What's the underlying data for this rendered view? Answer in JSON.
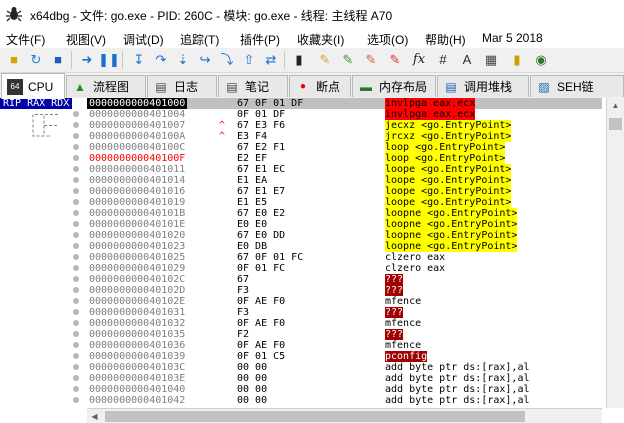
{
  "window": {
    "title": "x64dbg - 文件: go.exe - PID: 260C - 模块: go.exe - 线程: 主线程 A70"
  },
  "menu": {
    "items": [
      "文件(F)",
      "视图(V)",
      "调试(D)",
      "追踪(T)",
      "插件(P)",
      "收藏夹(I)",
      "选项(O)",
      "帮助(H)",
      "Mar 5 2018"
    ]
  },
  "tabs": [
    {
      "label": "CPU",
      "icon": "cpu-icon"
    },
    {
      "label": "流程图",
      "icon": "graph-icon"
    },
    {
      "label": "日志",
      "icon": "log-icon"
    },
    {
      "label": "笔记",
      "icon": "notes-icon"
    },
    {
      "label": "断点",
      "icon": "breakpoint-icon"
    },
    {
      "label": "内存布局",
      "icon": "memory-icon"
    },
    {
      "label": "调用堆栈",
      "icon": "callstack-icon"
    },
    {
      "label": "SEH链",
      "icon": "seh-icon"
    }
  ],
  "disasm": {
    "rip_label": "RIP RAX RDX",
    "rows": [
      {
        "addr": "0000000000401000",
        "mark": "",
        "bytes": "67 0F 01 DF",
        "instr": "invlpga",
        "arg": " eax,ecx",
        "style": "red"
      },
      {
        "addr": "0000000000401004",
        "mark": "",
        "bytes": "0F 01 DF",
        "instr": "invlpga",
        "arg": " eax,ecx",
        "style": "red"
      },
      {
        "addr": "0000000000401007",
        "mark": "^",
        "bytes": "67 E3 F6",
        "instr": "jecxz",
        "arg": " <go.EntryPoint>",
        "style": "yellow"
      },
      {
        "addr": "000000000040100A",
        "mark": "^",
        "bytes": "E3 F4",
        "instr": "jrcxz",
        "arg": " <go.EntryPoint>",
        "style": "yellow"
      },
      {
        "addr": "000000000040100C",
        "mark": "",
        "bytes": "67 E2 F1",
        "instr": "loop",
        "arg": " <go.EntryPoint>",
        "style": "yellow"
      },
      {
        "addr": "000000000040100F",
        "mark": "",
        "bytes": "E2 EF",
        "instr": "loop",
        "arg": " <go.EntryPoint>",
        "style": "yellow",
        "bp": true
      },
      {
        "addr": "0000000000401011",
        "mark": "",
        "bytes": "67 E1 EC",
        "instr": "loope",
        "arg": " <go.EntryPoint>",
        "style": "yellow"
      },
      {
        "addr": "0000000000401014",
        "mark": "",
        "bytes": "E1 EA",
        "instr": "loope",
        "arg": " <go.EntryPoint>",
        "style": "yellow"
      },
      {
        "addr": "0000000000401016",
        "mark": "",
        "bytes": "67 E1 E7",
        "instr": "loope",
        "arg": " <go.EntryPoint>",
        "style": "yellow"
      },
      {
        "addr": "0000000000401019",
        "mark": "",
        "bytes": "E1 E5",
        "instr": "loope",
        "arg": " <go.EntryPoint>",
        "style": "yellow"
      },
      {
        "addr": "000000000040101B",
        "mark": "",
        "bytes": "67 E0 E2",
        "instr": "loopne",
        "arg": " <go.EntryPoint>",
        "style": "yellow"
      },
      {
        "addr": "000000000040101E",
        "mark": "",
        "bytes": "E0 E0",
        "instr": "loopne",
        "arg": " <go.EntryPoint>",
        "style": "yellow"
      },
      {
        "addr": "0000000000401020",
        "mark": "",
        "bytes": "67 E0 DD",
        "instr": "loopne",
        "arg": " <go.EntryPoint>",
        "style": "yellow"
      },
      {
        "addr": "0000000000401023",
        "mark": "",
        "bytes": "E0 DB",
        "instr": "loopne",
        "arg": " <go.EntryPoint>",
        "style": "yellow"
      },
      {
        "addr": "0000000000401025",
        "mark": "",
        "bytes": "67 0F 01 FC",
        "instr": "clzero",
        "arg": " eax",
        "style": "none"
      },
      {
        "addr": "0000000000401029",
        "mark": "",
        "bytes": "0F 01 FC",
        "instr": "clzero",
        "arg": " eax",
        "style": "none"
      },
      {
        "addr": "000000000040102C",
        "mark": "",
        "bytes": "67",
        "instr": "???",
        "arg": "",
        "style": "dred"
      },
      {
        "addr": "000000000040102D",
        "mark": "",
        "bytes": "F3",
        "instr": "???",
        "arg": "",
        "style": "dred"
      },
      {
        "addr": "000000000040102E",
        "mark": "",
        "bytes": "0F AE F0",
        "instr": "mfence",
        "arg": "",
        "style": "none"
      },
      {
        "addr": "0000000000401031",
        "mark": "",
        "bytes": "F3",
        "instr": "???",
        "arg": "",
        "style": "dred"
      },
      {
        "addr": "0000000000401032",
        "mark": "",
        "bytes": "0F AE F0",
        "instr": "mfence",
        "arg": "",
        "style": "none"
      },
      {
        "addr": "0000000000401035",
        "mark": "",
        "bytes": "F2",
        "instr": "???",
        "arg": "",
        "style": "dred"
      },
      {
        "addr": "0000000000401036",
        "mark": "",
        "bytes": "0F AE F0",
        "instr": "mfence",
        "arg": "",
        "style": "none"
      },
      {
        "addr": "0000000000401039",
        "mark": "",
        "bytes": "0F 01 C5",
        "instr": "pconfig",
        "arg": "",
        "style": "dred"
      },
      {
        "addr": "000000000040103C",
        "mark": "",
        "bytes": "00 00",
        "instr": "add",
        "arg": " byte ptr ds:[rax],al",
        "style": "none"
      },
      {
        "addr": "000000000040103E",
        "mark": "",
        "bytes": "00 00",
        "instr": "add",
        "arg": " byte ptr ds:[rax],al",
        "style": "none"
      },
      {
        "addr": "0000000000401040",
        "mark": "",
        "bytes": "00 00",
        "instr": "add",
        "arg": " byte ptr ds:[rax],al",
        "style": "none"
      },
      {
        "addr": "0000000000401042",
        "mark": "",
        "bytes": "00 00",
        "instr": "add",
        "arg": " byte ptr ds:[rax],al",
        "style": "none"
      }
    ]
  },
  "colors": {
    "rip_bg": "#0000a8",
    "invalid_red": "#ff0000",
    "branch_yellow": "#ffff00",
    "unknown_dark_red": "#a00000"
  }
}
